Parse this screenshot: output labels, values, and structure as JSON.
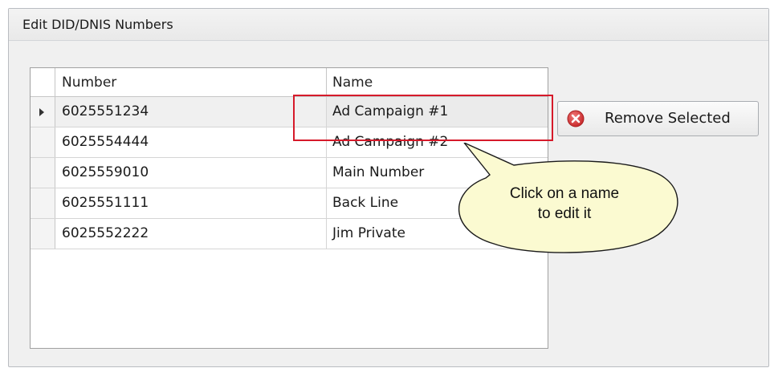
{
  "panel": {
    "title": "Edit DID/DNIS Numbers"
  },
  "grid": {
    "columns": [
      "Number",
      "Name"
    ],
    "rows": [
      {
        "number": "6025551234",
        "name": "Ad Campaign #1",
        "selected": true
      },
      {
        "number": "6025554444",
        "name": "Ad Campaign #2",
        "selected": false
      },
      {
        "number": "6025559010",
        "name": "Main Number",
        "selected": false
      },
      {
        "number": "6025551111",
        "name": "Back Line",
        "selected": false
      },
      {
        "number": "6025552222",
        "name": "Jim Private",
        "selected": false
      }
    ]
  },
  "remove_button": {
    "label": "Remove Selected",
    "icon": "remove-icon",
    "icon_color": "#d9383a"
  },
  "callout": {
    "line1": "Click on a name",
    "line2": "to edit it",
    "fill_color": "#fbfad1",
    "highlight_color": "#d61a2a"
  }
}
